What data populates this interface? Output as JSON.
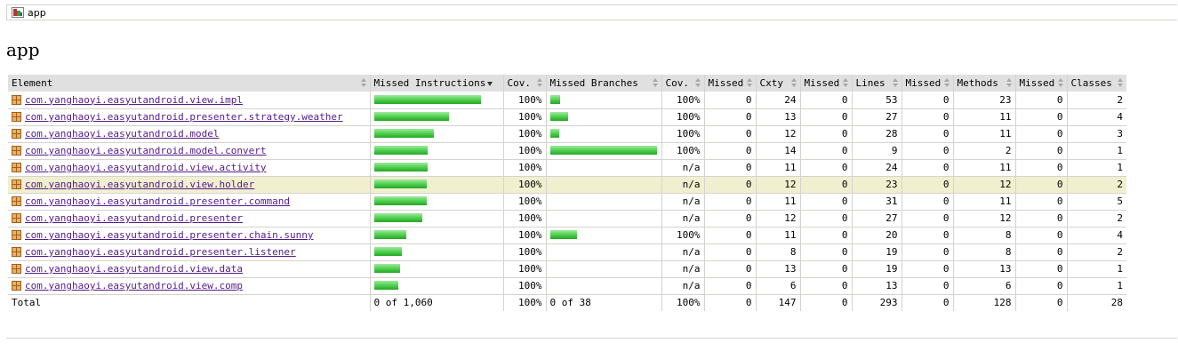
{
  "breadcrumb": {
    "label": "app",
    "icon": "report-icon"
  },
  "page": {
    "title": "app"
  },
  "table": {
    "headers": [
      "Element",
      "Missed Instructions",
      "Cov.",
      "Missed Branches",
      "Cov.",
      "Missed",
      "Cxty",
      "Missed",
      "Lines",
      "Missed",
      "Methods",
      "Missed",
      "Classes"
    ],
    "sorted_column": "Missed Instructions",
    "rows": [
      {
        "element": "com.yanghaoyi.easyutandroid.view.impl",
        "instr_bar": 120,
        "instr_cov": "100%",
        "branch_bar": 11,
        "branch_cov": "100%",
        "cxty_missed": "0",
        "cxty": "24",
        "lines_missed": "0",
        "lines": "53",
        "methods_missed": "0",
        "methods": "23",
        "classes_missed": "0",
        "classes": "2"
      },
      {
        "element": "com.yanghaoyi.easyutandroid.presenter.strategy.weather",
        "instr_bar": 84,
        "instr_cov": "100%",
        "branch_bar": 20,
        "branch_cov": "100%",
        "cxty_missed": "0",
        "cxty": "13",
        "lines_missed": "0",
        "lines": "27",
        "methods_missed": "0",
        "methods": "11",
        "classes_missed": "0",
        "classes": "4"
      },
      {
        "element": "com.yanghaoyi.easyutandroid.model",
        "instr_bar": 67,
        "instr_cov": "100%",
        "branch_bar": 10,
        "branch_cov": "100%",
        "cxty_missed": "0",
        "cxty": "12",
        "lines_missed": "0",
        "lines": "28",
        "methods_missed": "0",
        "methods": "11",
        "classes_missed": "0",
        "classes": "3"
      },
      {
        "element": "com.yanghaoyi.easyutandroid.model.convert",
        "instr_bar": 60,
        "instr_cov": "100%",
        "branch_bar": 120,
        "branch_cov": "100%",
        "cxty_missed": "0",
        "cxty": "14",
        "lines_missed": "0",
        "lines": "9",
        "methods_missed": "0",
        "methods": "2",
        "classes_missed": "0",
        "classes": "1"
      },
      {
        "element": "com.yanghaoyi.easyutandroid.view.activity",
        "instr_bar": 60,
        "instr_cov": "100%",
        "branch_bar": 0,
        "branch_cov": "n/a",
        "cxty_missed": "0",
        "cxty": "11",
        "lines_missed": "0",
        "lines": "24",
        "methods_missed": "0",
        "methods": "11",
        "classes_missed": "0",
        "classes": "1"
      },
      {
        "element": "com.yanghaoyi.easyutandroid.view.holder",
        "instr_bar": 59,
        "instr_cov": "100%",
        "branch_bar": 0,
        "branch_cov": "n/a",
        "cxty_missed": "0",
        "cxty": "12",
        "lines_missed": "0",
        "lines": "23",
        "methods_missed": "0",
        "methods": "12",
        "classes_missed": "0",
        "classes": "2",
        "highlighted": true
      },
      {
        "element": "com.yanghaoyi.easyutandroid.presenter.command",
        "instr_bar": 59,
        "instr_cov": "100%",
        "branch_bar": 0,
        "branch_cov": "n/a",
        "cxty_missed": "0",
        "cxty": "11",
        "lines_missed": "0",
        "lines": "31",
        "methods_missed": "0",
        "methods": "11",
        "classes_missed": "0",
        "classes": "5"
      },
      {
        "element": "com.yanghaoyi.easyutandroid.presenter",
        "instr_bar": 54,
        "instr_cov": "100%",
        "branch_bar": 0,
        "branch_cov": "n/a",
        "cxty_missed": "0",
        "cxty": "12",
        "lines_missed": "0",
        "lines": "27",
        "methods_missed": "0",
        "methods": "12",
        "classes_missed": "0",
        "classes": "2"
      },
      {
        "element": "com.yanghaoyi.easyutandroid.presenter.chain.sunny",
        "instr_bar": 36,
        "instr_cov": "100%",
        "branch_bar": 30,
        "branch_cov": "100%",
        "cxty_missed": "0",
        "cxty": "11",
        "lines_missed": "0",
        "lines": "20",
        "methods_missed": "0",
        "methods": "8",
        "classes_missed": "0",
        "classes": "4"
      },
      {
        "element": "com.yanghaoyi.easyutandroid.presenter.listener",
        "instr_bar": 31,
        "instr_cov": "100%",
        "branch_bar": 0,
        "branch_cov": "n/a",
        "cxty_missed": "0",
        "cxty": "8",
        "lines_missed": "0",
        "lines": "19",
        "methods_missed": "0",
        "methods": "8",
        "classes_missed": "0",
        "classes": "2"
      },
      {
        "element": "com.yanghaoyi.easyutandroid.view.data",
        "instr_bar": 29,
        "instr_cov": "100%",
        "branch_bar": 0,
        "branch_cov": "n/a",
        "cxty_missed": "0",
        "cxty": "13",
        "lines_missed": "0",
        "lines": "19",
        "methods_missed": "0",
        "methods": "13",
        "classes_missed": "0",
        "classes": "1"
      },
      {
        "element": "com.yanghaoyi.easyutandroid.view.comp",
        "instr_bar": 27,
        "instr_cov": "100%",
        "branch_bar": 0,
        "branch_cov": "n/a",
        "cxty_missed": "0",
        "cxty": "6",
        "lines_missed": "0",
        "lines": "13",
        "methods_missed": "0",
        "methods": "6",
        "classes_missed": "0",
        "classes": "1"
      }
    ],
    "total": {
      "label": "Total",
      "instructions": "0 of 1,060",
      "instr_cov": "100%",
      "branches": "0 of 38",
      "branch_cov": "100%",
      "cxty_missed": "0",
      "cxty": "147",
      "lines_missed": "0",
      "lines": "293",
      "methods_missed": "0",
      "methods": "128",
      "classes_missed": "0",
      "classes": "28"
    }
  },
  "colors": {
    "bar_green": "#21a821",
    "header_bg": "#e0e0e0",
    "highlight_row": "#f0f0d0",
    "link": "#551a8b"
  }
}
